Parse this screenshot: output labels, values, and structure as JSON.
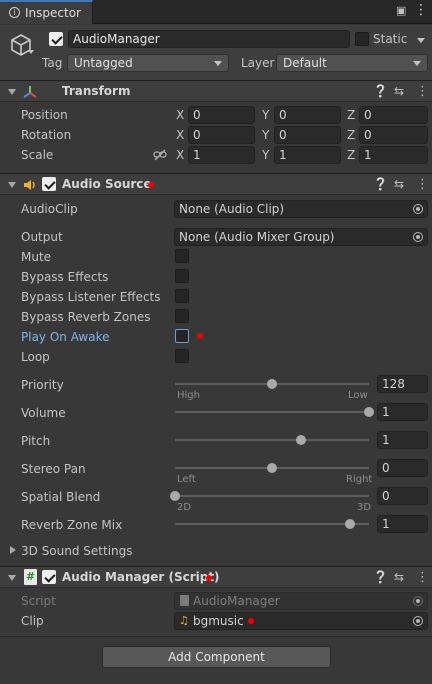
{
  "window": {
    "tab": "Inspector"
  },
  "object": {
    "name": "AudioManager",
    "active": true,
    "static_label": "Static",
    "tag_label": "Tag",
    "tag": "Untagged",
    "layer_label": "Layer",
    "layer": "Default"
  },
  "transform": {
    "title": "Transform",
    "position_label": "Position",
    "rotation_label": "Rotation",
    "scale_label": "Scale",
    "axes": [
      "X",
      "Y",
      "Z"
    ],
    "position": [
      "0",
      "0",
      "0"
    ],
    "rotation": [
      "0",
      "0",
      "0"
    ],
    "scale": [
      "1",
      "1",
      "1"
    ]
  },
  "audio_source": {
    "title": "Audio Source",
    "enabled": true,
    "clip_label": "AudioClip",
    "clip": "None (Audio Clip)",
    "output_label": "Output",
    "output": "None (Audio Mixer Group)",
    "mute_label": "Mute",
    "mute": false,
    "bypass_effects_label": "Bypass Effects",
    "bypass_effects": false,
    "bypass_listener_label": "Bypass Listener Effects",
    "bypass_listener": false,
    "bypass_reverb_label": "Bypass Reverb Zones",
    "bypass_reverb": false,
    "play_on_awake_label": "Play On Awake",
    "play_on_awake": false,
    "loop_label": "Loop",
    "loop": false,
    "priority_label": "Priority",
    "priority": "128",
    "priority_low": "High",
    "priority_high": "Low",
    "priority_level": 0.5,
    "volume_label": "Volume",
    "volume": "1",
    "volume_level": 1.0,
    "pitch_label": "Pitch",
    "pitch": "1",
    "pitch_level": 0.65,
    "stereo_label": "Stereo Pan",
    "stereo": "0",
    "stereo_low": "Left",
    "stereo_high": "Right",
    "stereo_level": 0.5,
    "spatial_label": "Spatial Blend",
    "spatial": "0",
    "spatial_low": "2D",
    "spatial_high": "3D",
    "spatial_level": 0.0,
    "reverb_label": "Reverb Zone Mix",
    "reverb": "1",
    "reverb_level": 0.9,
    "sound3d_label": "3D Sound Settings"
  },
  "script_comp": {
    "title": "Audio Manager (Script)",
    "enabled": true,
    "script_label": "Script",
    "script": "AudioManager",
    "clip_label": "Clip",
    "clip": "bgmusic"
  },
  "add_component": "Add Component",
  "colors": {
    "accent": "#3a79bb",
    "modified": "#f60000",
    "panel": "#383838"
  }
}
